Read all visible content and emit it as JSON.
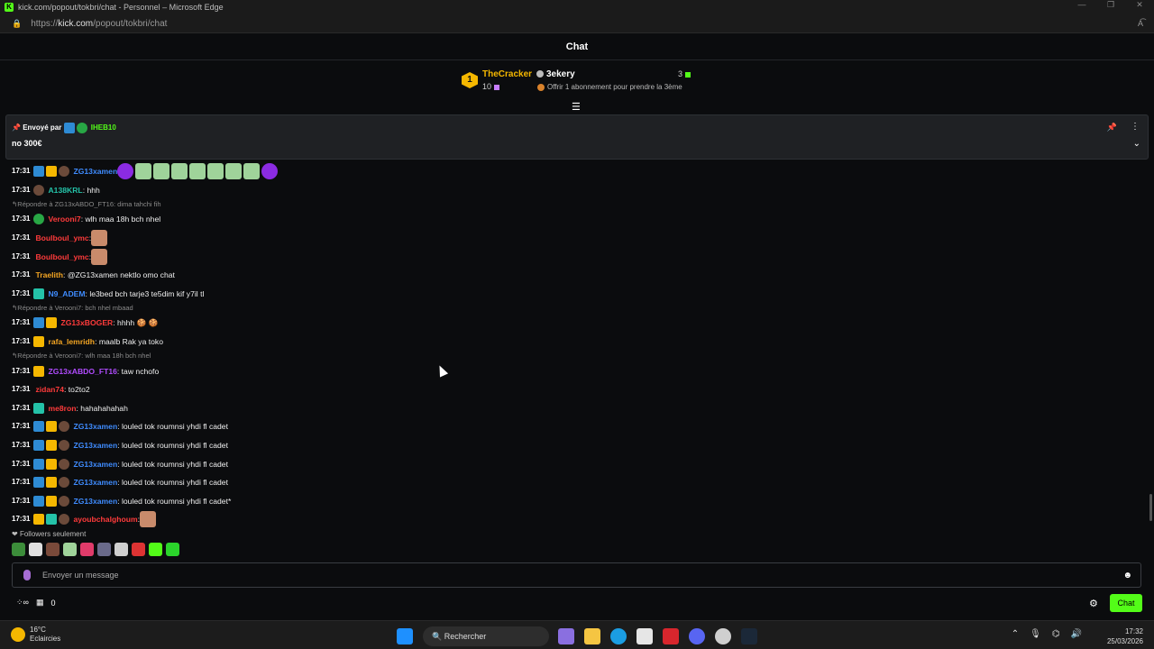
{
  "browser": {
    "title": "kick.com/popout/tokbri/chat - Personnel – Microsoft Edge",
    "url_prefix": "https://",
    "url_host": "kick.com",
    "url_path": "/popout/tokbri/chat"
  },
  "header": {
    "title": "Chat"
  },
  "leaderboard": {
    "rank": "1",
    "first_name": "TheCracker",
    "first_count": "10",
    "second_name": "3ekery",
    "second_count": "3",
    "offer": "Offrir 1 abonnement pour prendre la 3ème"
  },
  "pinned": {
    "sent_by_label": "Envoyé par",
    "user": "IHEB10",
    "message": "no 300€"
  },
  "messages": [
    {
      "type": "msg",
      "time": "17:31",
      "user": "ZG13xamen",
      "color": "#3f8cff",
      "badges": [
        "blue",
        "gold",
        "av"
      ],
      "text": "",
      "emotes": [
        "purple",
        "pepe",
        "pepe",
        "pepe",
        "pepe",
        "pepe",
        "pepe",
        "pepe",
        "purple"
      ]
    },
    {
      "type": "msg",
      "time": "17:31",
      "user": "A138KRL",
      "color": "#24c2a8",
      "badges": [
        "av"
      ],
      "text": ": hhh"
    },
    {
      "type": "reply",
      "text": "Répondre à ZG13xABDO_FT16: dima tahchi fih"
    },
    {
      "type": "msg",
      "time": "17:31",
      "user": "Verooni7",
      "color": "#ff3b3b",
      "badges": [
        "green"
      ],
      "text": ": wlh maa 18h bch nhel"
    },
    {
      "type": "msg",
      "time": "17:31",
      "user": "Boulboul_ymc",
      "color": "#ff3b3b",
      "badges": [],
      "text": ":",
      "emotes": [
        "face"
      ]
    },
    {
      "type": "msg",
      "time": "17:31",
      "user": "Boulboul_ymc",
      "color": "#ff3b3b",
      "badges": [],
      "text": ":",
      "emotes": [
        "face"
      ]
    },
    {
      "type": "msg",
      "time": "17:31",
      "user": "Traelith",
      "color": "#f5a623",
      "badges": [],
      "text": ": @ZG13xamen nektlo omo chat"
    },
    {
      "type": "msg",
      "time": "17:31",
      "user": "N9_ADEM",
      "color": "#3f8cff",
      "badges": [
        "teal"
      ],
      "text": ": le3bed bch tarje3 te5dim kif y7il tl"
    },
    {
      "type": "reply",
      "text": "Répondre à Verooni7: bch nhel mbaad"
    },
    {
      "type": "msg",
      "time": "17:31",
      "user": "ZG13xBOGER",
      "color": "#ff3b3b",
      "badges": [
        "blue",
        "gold"
      ],
      "text": ": hhhh 🍪 🍪"
    },
    {
      "type": "msg",
      "time": "17:31",
      "user": "rafa_lemridh",
      "color": "#f5a623",
      "badges": [
        "gold"
      ],
      "text": ": maalb Rak ya toko"
    },
    {
      "type": "reply",
      "text": "Répondre à Verooni7: wlh maa 18h bch nhel"
    },
    {
      "type": "msg",
      "time": "17:31",
      "user": "ZG13xABDO_FT16",
      "color": "#b14cff",
      "badges": [
        "gold"
      ],
      "text": ": taw nchofo"
    },
    {
      "type": "msg",
      "time": "17:31",
      "user": "zidan74",
      "color": "#ff3b3b",
      "badges": [],
      "text": ": to2to2"
    },
    {
      "type": "msg",
      "time": "17:31",
      "user": "me8ron",
      "color": "#ff3b3b",
      "badges": [
        "teal"
      ],
      "text": ": hahahahahah"
    },
    {
      "type": "msg",
      "time": "17:31",
      "user": "ZG13xamen",
      "color": "#3f8cff",
      "badges": [
        "blue",
        "gold",
        "av"
      ],
      "text": ": louled tok roumnsi yhdi fl cadet"
    },
    {
      "type": "msg",
      "time": "17:31",
      "user": "ZG13xamen",
      "color": "#3f8cff",
      "badges": [
        "blue",
        "gold",
        "av"
      ],
      "text": ": louled tok roumnsi yhdi fl cadet"
    },
    {
      "type": "msg",
      "time": "17:31",
      "user": "ZG13xamen",
      "color": "#3f8cff",
      "badges": [
        "blue",
        "gold",
        "av"
      ],
      "text": ": louled tok roumnsi yhdi fl cadet"
    },
    {
      "type": "msg",
      "time": "17:31",
      "user": "ZG13xamen",
      "color": "#3f8cff",
      "badges": [
        "blue",
        "gold",
        "av"
      ],
      "text": ": louled tok roumnsi yhdi fl cadet"
    },
    {
      "type": "msg",
      "time": "17:31",
      "user": "ZG13xamen",
      "color": "#3f8cff",
      "badges": [
        "blue",
        "gold",
        "av"
      ],
      "text": ": louled tok roumnsi yhdi fl cadet*"
    },
    {
      "type": "msg",
      "time": "17:31",
      "user": "ayoubchalghoum",
      "color": "#ff3b3b",
      "badges": [
        "gold",
        "teal",
        "av"
      ],
      "text": ":",
      "emotes": [
        "face"
      ]
    }
  ],
  "followers_label": "Followers seulement",
  "input": {
    "placeholder": "Envoyer un message"
  },
  "footer": {
    "points": "0",
    "chat_button": "Chat"
  },
  "taskbar": {
    "temp": "16°C",
    "weather": "Eclaircies",
    "search": "Rechercher",
    "time": "17:32",
    "date": "25/03/2026"
  }
}
